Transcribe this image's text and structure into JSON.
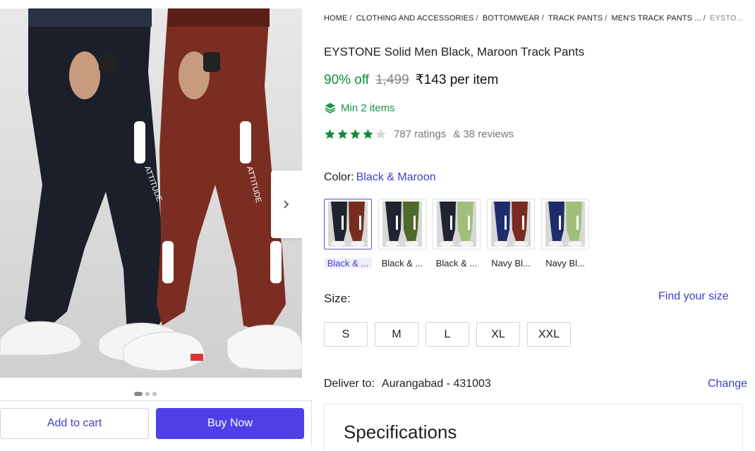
{
  "gallery": {
    "figure_text_left": "ATTITUDE",
    "figure_text_right": "ATTITUDE",
    "dot_count": 3,
    "active_dot": 1
  },
  "actions": {
    "add_to_cart": "Add to cart",
    "buy_now": "Buy Now"
  },
  "breadcrumb": [
    "HOME",
    "CLOTHING AND ACCESSORIES",
    "BOTTOMWEAR",
    "TRACK PANTS",
    "MEN'S TRACK PANTS ...",
    "EYSTO..."
  ],
  "product": {
    "title": "EYSTONE Solid Men Black, Maroon Track Pants",
    "discount": "90% off",
    "mrp": "1,499",
    "price": "₹143 per item",
    "min_items": "Min 2 items",
    "rating": 4,
    "ratings_text": "787 ratings",
    "reviews_text": "& 38 reviews"
  },
  "color": {
    "label": "Color:",
    "value": "Black & Maroon",
    "swatches": [
      {
        "label": "Black & ...",
        "c1": "#1f2430",
        "c2": "#7a2b20",
        "selected": true
      },
      {
        "label": "Black & ...",
        "c1": "#1f2430",
        "c2": "#4f6a2a",
        "selected": false
      },
      {
        "label": "Black & ...",
        "c1": "#1f2430",
        "c2": "#9fbf7a",
        "selected": false
      },
      {
        "label": "Navy Bl...",
        "c1": "#1d2d6b",
        "c2": "#7a2b20",
        "selected": false
      },
      {
        "label": "Navy Bl...",
        "c1": "#1d2d6b",
        "c2": "#9fbf7a",
        "selected": false
      }
    ]
  },
  "size": {
    "label": "Size:",
    "find_link": "Find your size",
    "options": [
      "S",
      "M",
      "L",
      "XL",
      "XXL"
    ]
  },
  "delivery": {
    "label": "Deliver to:",
    "address": "Aurangabad - 431003",
    "change": "Change"
  },
  "specifications": {
    "title": "Specifications"
  },
  "colors": {
    "accent": "#3f3fc8",
    "buy_button": "#4f3fe6",
    "green": "#118c3d",
    "star": "#148a3b"
  }
}
